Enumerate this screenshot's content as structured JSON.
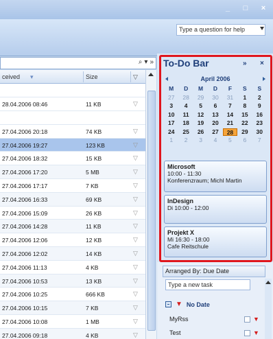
{
  "window": {
    "controls": [
      "_",
      "□",
      "×"
    ],
    "help_placeholder": "Type a question for help"
  },
  "search": {
    "icon": "search-icon"
  },
  "list": {
    "columns": {
      "received": "ceived",
      "size": "Size"
    },
    "rows": [
      {
        "date": "",
        "size": "",
        "kind": "group"
      },
      {
        "date": "28.04.2006 08:46",
        "size": "11 KB"
      },
      {
        "date": "",
        "size": "",
        "kind": "group"
      },
      {
        "date": "27.04.2006 20:18",
        "size": "74 KB"
      },
      {
        "date": "27.04.2006 19:27",
        "size": "123 KB",
        "selected": true
      },
      {
        "date": "27.04.2006 18:32",
        "size": "15 KB"
      },
      {
        "date": "27.04.2006 17:20",
        "size": "5 MB"
      },
      {
        "date": "27.04.2006 17:17",
        "size": "7 KB"
      },
      {
        "date": "27.04.2006 16:33",
        "size": "69 KB"
      },
      {
        "date": "27.04.2006 15:09",
        "size": "26 KB"
      },
      {
        "date": "27.04.2006 14:28",
        "size": "11 KB"
      },
      {
        "date": "27.04.2006 12:06",
        "size": "12 KB"
      },
      {
        "date": "27.04.2006 12:02",
        "size": "14 KB"
      },
      {
        "date": "27.04.2006 11:13",
        "size": "4 KB"
      },
      {
        "date": "27.04.2006 10:53",
        "size": "13 KB"
      },
      {
        "date": "27.04.2006 10:25",
        "size": "666 KB"
      },
      {
        "date": "27.04.2006 10:15",
        "size": "7 KB"
      },
      {
        "date": "27.04.2006 10:08",
        "size": "1 MB"
      },
      {
        "date": "27.04.2006 09:18",
        "size": "4 KB"
      }
    ]
  },
  "todo": {
    "title": "To-Do Bar",
    "expand_label": "»",
    "close_label": "×",
    "calendar": {
      "month": "April 2006",
      "weekdays": [
        "M",
        "D",
        "M",
        "D",
        "F",
        "S",
        "S"
      ],
      "days": [
        {
          "d": "27",
          "dim": true
        },
        {
          "d": "28",
          "dim": true
        },
        {
          "d": "29",
          "dim": true
        },
        {
          "d": "30",
          "dim": true
        },
        {
          "d": "31",
          "dim": true
        },
        {
          "d": "1",
          "bold": true
        },
        {
          "d": "2",
          "bold": true
        },
        {
          "d": "3",
          "bold": true
        },
        {
          "d": "4",
          "bold": true
        },
        {
          "d": "5",
          "bold": true
        },
        {
          "d": "6",
          "bold": true
        },
        {
          "d": "7",
          "bold": true
        },
        {
          "d": "8",
          "bold": true
        },
        {
          "d": "9",
          "bold": true
        },
        {
          "d": "10",
          "bold": true
        },
        {
          "d": "11",
          "bold": true
        },
        {
          "d": "12",
          "bold": true
        },
        {
          "d": "13",
          "bold": true
        },
        {
          "d": "14",
          "bold": true
        },
        {
          "d": "15",
          "bold": true
        },
        {
          "d": "16",
          "bold": true
        },
        {
          "d": "17",
          "bold": true
        },
        {
          "d": "18",
          "bold": true
        },
        {
          "d": "19",
          "bold": true
        },
        {
          "d": "20",
          "bold": true
        },
        {
          "d": "21",
          "bold": true
        },
        {
          "d": "22",
          "bold": true
        },
        {
          "d": "23",
          "bold": true
        },
        {
          "d": "24",
          "bold": true
        },
        {
          "d": "25",
          "bold": true
        },
        {
          "d": "26",
          "bold": true
        },
        {
          "d": "27",
          "bold": true
        },
        {
          "d": "28",
          "today": true
        },
        {
          "d": "29",
          "bold": true
        },
        {
          "d": "30",
          "bold": true
        },
        {
          "d": "1",
          "dim": true
        },
        {
          "d": "2",
          "dim": true
        },
        {
          "d": "3",
          "dim": true
        },
        {
          "d": "4",
          "dim": true
        },
        {
          "d": "5",
          "dim": true
        },
        {
          "d": "6",
          "dim": true
        },
        {
          "d": "7",
          "dim": true
        }
      ]
    },
    "appointments": [
      {
        "title": "Microsoft",
        "line1": "10:00 - 11:30",
        "line2": "Konferenzraum; Michl Martin"
      },
      {
        "title": "InDesign",
        "line1": "Di 10:00 - 12:00",
        "line2": ""
      },
      {
        "title": "Projekt X",
        "line1": "Mi 16:30 - 18:00",
        "line2": "Cafe Reitschule"
      }
    ],
    "tasks": {
      "arranged_by": "Arranged By: Due Date",
      "new_task_placeholder": "Type a new task",
      "group_label": "No Date",
      "items": [
        "MyRss",
        "Test"
      ]
    }
  },
  "colors": {
    "highlight_frame": "#e0161e",
    "today": "#f6a43a",
    "selection": "#a9c5ec"
  }
}
